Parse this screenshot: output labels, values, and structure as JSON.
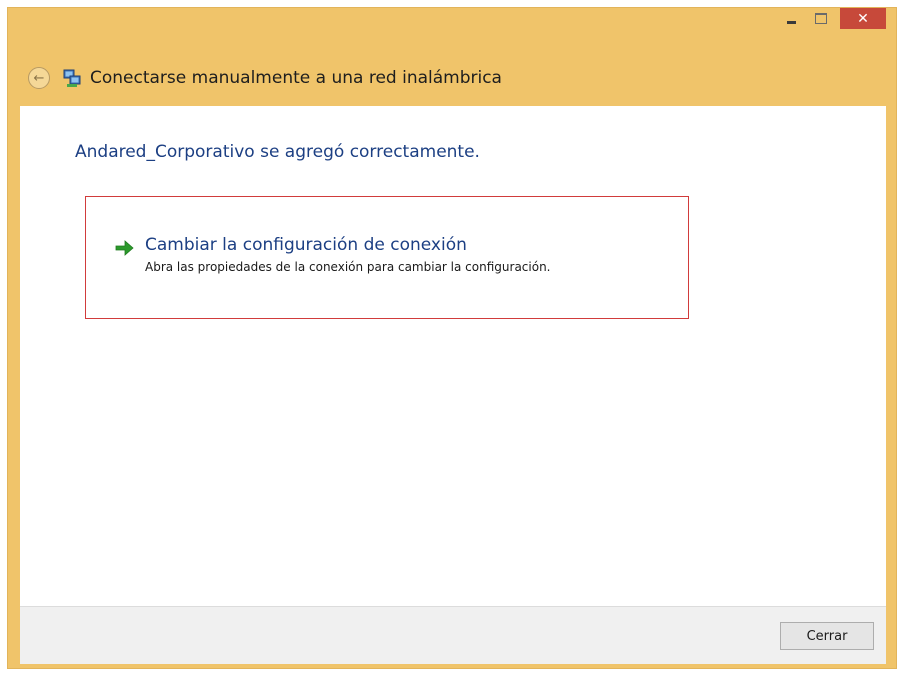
{
  "window": {
    "controls": {
      "minimize": "minimize-icon",
      "maximize": "maximize-icon",
      "close_glyph": "✕"
    }
  },
  "nav": {
    "back_glyph": "←",
    "title": "Conectarse manualmente a una red inalámbrica"
  },
  "main": {
    "success_message": "Andared_Corporativo se agregó correctamente.",
    "option": {
      "title": "Cambiar la configuración de conexión",
      "description": "Abra las propiedades de la conexión para cambiar la configuración."
    }
  },
  "footer": {
    "close_label": "Cerrar"
  },
  "colors": {
    "title_bar": "#f0c46a",
    "link_blue": "#1c3f83",
    "highlight_border": "#d13b3b",
    "close_button": "#c7493a",
    "arrow_green": "#2c9a2c"
  }
}
